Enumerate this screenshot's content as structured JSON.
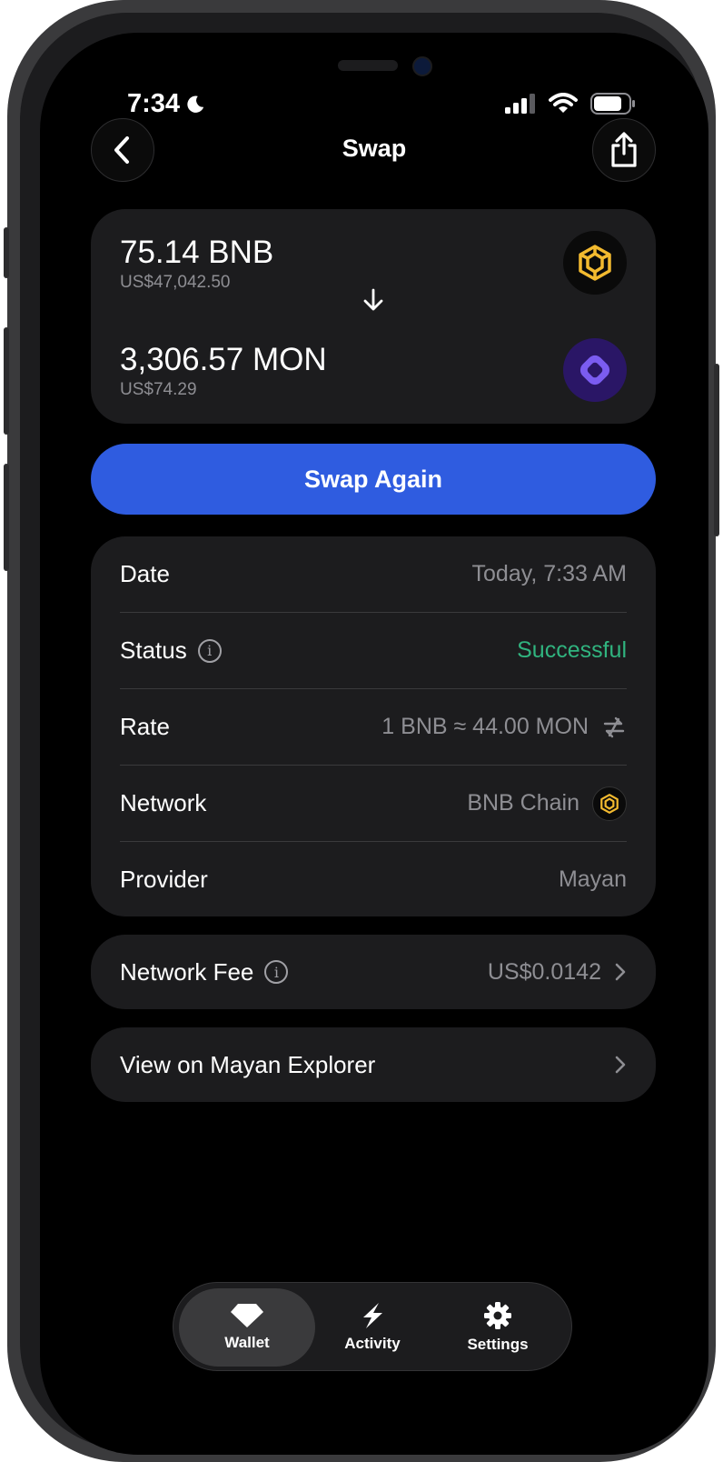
{
  "status_bar": {
    "time": "7:34"
  },
  "header": {
    "title": "Swap"
  },
  "swap_card": {
    "from_amount": "75.14 BNB",
    "from_fiat": "US$47,042.50",
    "to_amount": "3,306.57 MON",
    "to_fiat": "US$74.29"
  },
  "swap_again_label": "Swap Again",
  "details": {
    "date": {
      "label": "Date",
      "value": "Today, 7:33 AM"
    },
    "status": {
      "label": "Status",
      "value": "Successful"
    },
    "rate": {
      "label": "Rate",
      "value": "1 BNB ≈ 44.00 MON"
    },
    "network": {
      "label": "Network",
      "value": "BNB Chain"
    },
    "provider": {
      "label": "Provider",
      "value": "Mayan"
    }
  },
  "fee": {
    "label": "Network Fee",
    "value": "US$0.0142"
  },
  "explorer": {
    "label": "View on Mayan Explorer"
  },
  "tab_bar": {
    "items": [
      {
        "label": "Wallet",
        "icon": "diamond-icon"
      },
      {
        "label": "Activity",
        "icon": "lightning-icon"
      },
      {
        "label": "Settings",
        "icon": "gear-icon"
      }
    ]
  },
  "colors": {
    "accent": "#2F5CE0",
    "success": "#30B47F",
    "bnb": "#F3BA2F",
    "mon": "#7B5CF0"
  }
}
